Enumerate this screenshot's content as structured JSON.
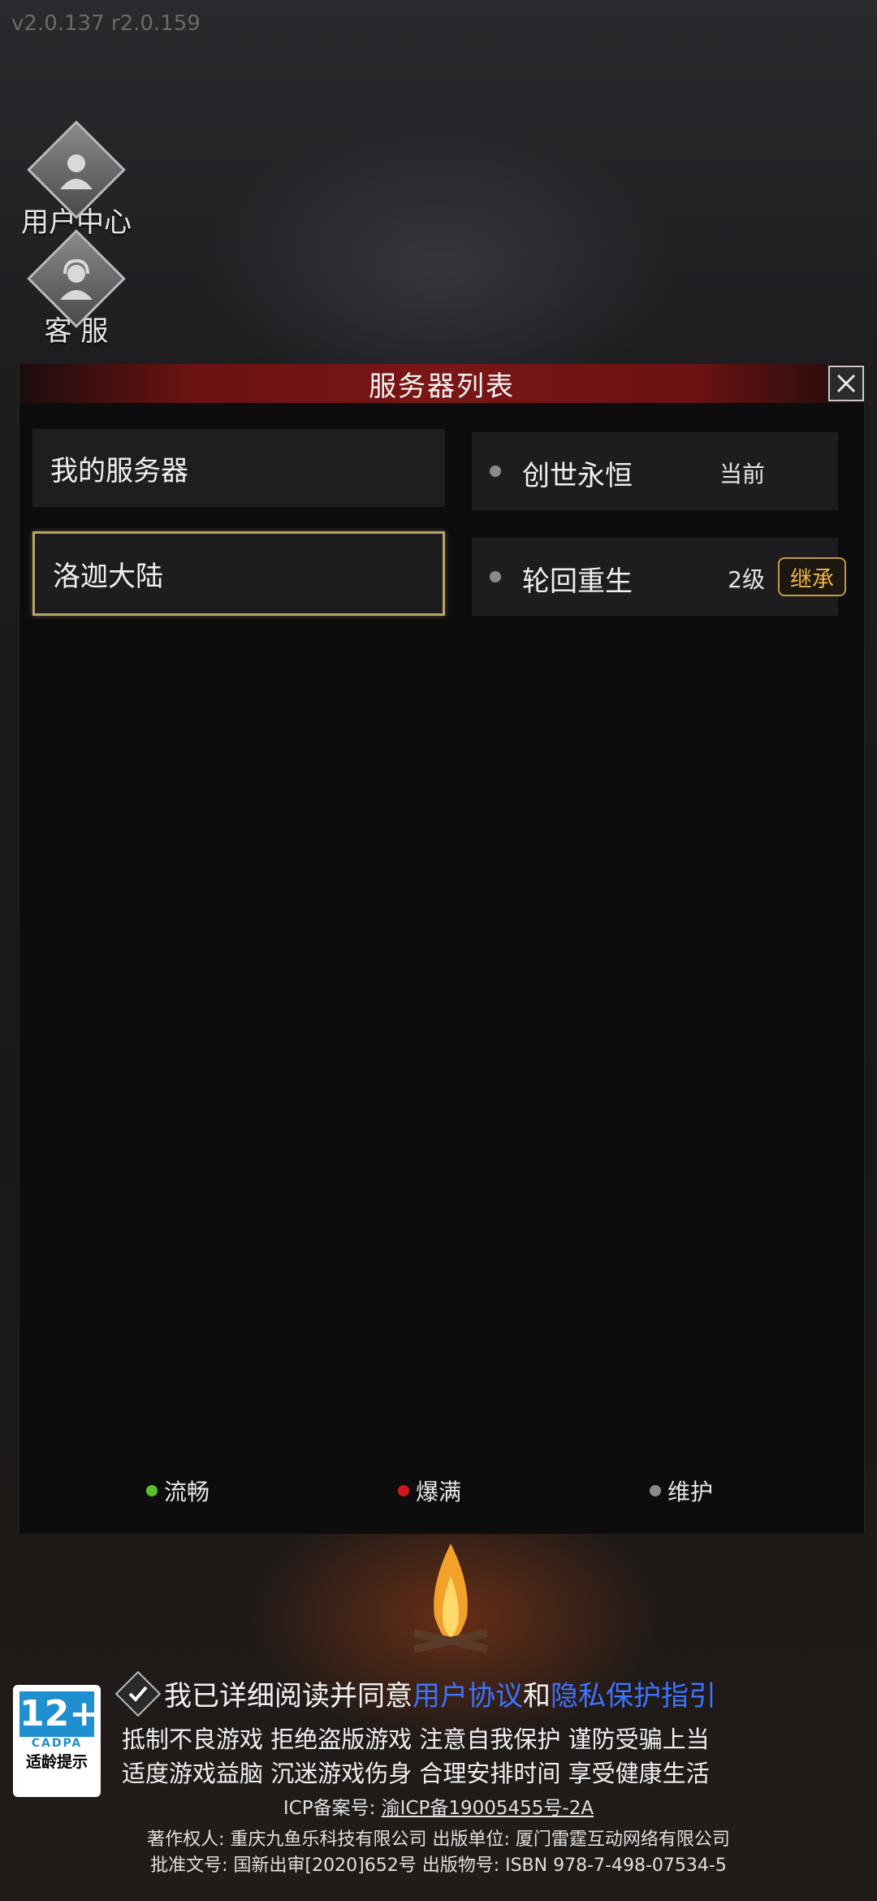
{
  "version": "v2.0.137 r2.0.159",
  "side_buttons": [
    {
      "label": "用户中心"
    },
    {
      "label": "客 服"
    }
  ],
  "panel": {
    "title": "服务器列表",
    "left_items": [
      {
        "label": "我的服务器",
        "selected": false
      },
      {
        "label": "洛迦大陆",
        "selected": true
      }
    ],
    "right_items": [
      {
        "name": "创世永恒",
        "tag": "当前"
      },
      {
        "name": "轮回重生",
        "tag": "2级",
        "action": "继承"
      }
    ]
  },
  "legend": [
    {
      "label": "流畅",
      "color": "#58c02a"
    },
    {
      "label": "爆满",
      "color": "#d01818"
    },
    {
      "label": "维护",
      "color": "#8a8a8a"
    }
  ],
  "footer": {
    "agree_prefix": "我已详细阅读并同意",
    "agree_link1": "用户协议",
    "agree_and": "和",
    "agree_link2": "隐私保护指引",
    "warn_line1": "抵制不良游戏 拒绝盗版游戏 注意自我保护 谨防受骗上当",
    "warn_line2": "适度游戏益脑 沉迷游戏伤身 合理安排时间 享受健康生活",
    "icp_label": "ICP备案号:",
    "icp_value": "渝ICP备19005455号-2A",
    "copyright_line": "著作权人: 重庆九鱼乐科技有限公司 出版单位: 厦门雷霆互动网络有限公司",
    "approval_line": "批准文号: 国新出审[2020]652号 出版物号: ISBN 978-7-498-07534-5"
  },
  "age_badge": {
    "rating": "12+",
    "org": "CADPA",
    "label": "适龄提示"
  }
}
